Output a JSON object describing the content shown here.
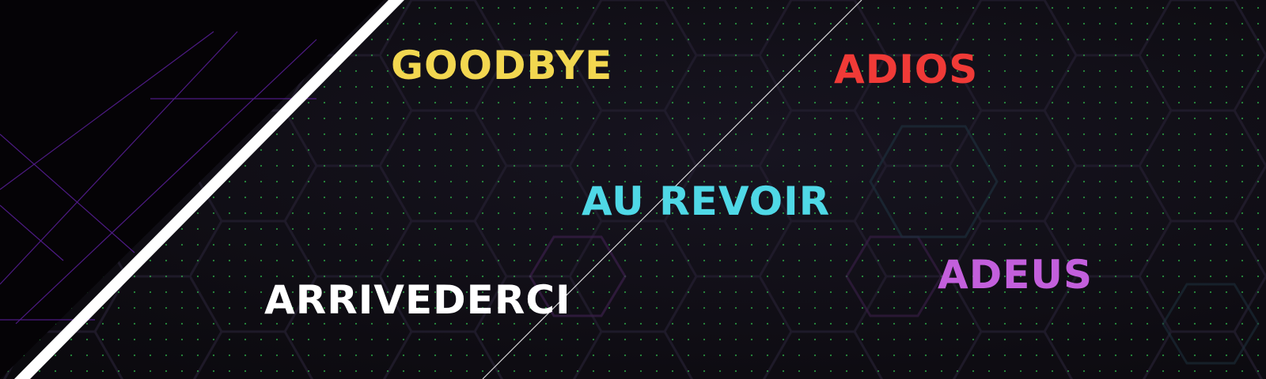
{
  "words": {
    "goodbye": "GOODBYE",
    "adios": "ADIOS",
    "au_revoir": "AU REVOIR",
    "adeus": "ADEUS",
    "arrivederci": "ARRIVEDERCI"
  },
  "colors": {
    "goodbye": "#f2d750",
    "adios": "#f03a37",
    "au_revoir": "#4fd8e6",
    "adeus": "#c35fdc",
    "arrivederci": "#ffffff",
    "background": "#0f0d14",
    "dots": "#2fb84a",
    "stripe": "#ffffff",
    "purple_lines": "#5a1f9a"
  }
}
